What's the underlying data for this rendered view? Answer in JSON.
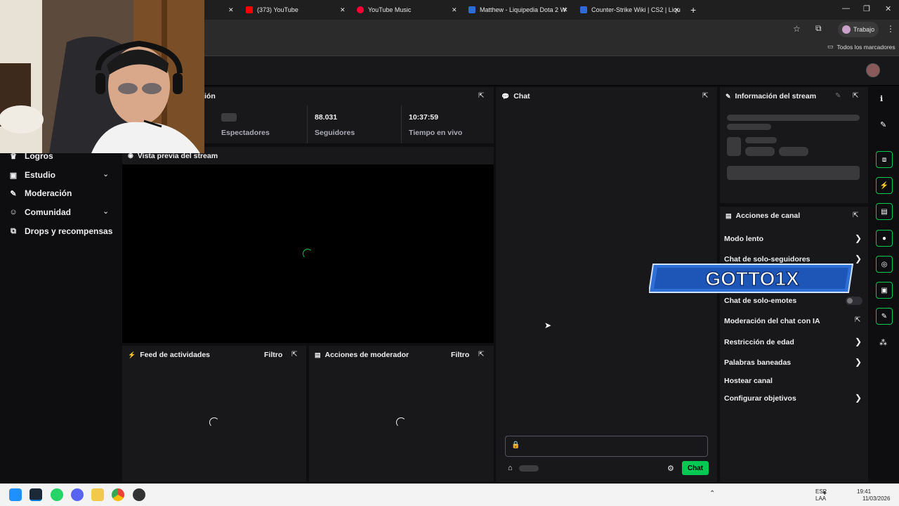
{
  "browser": {
    "tabs": [
      {
        "label": "(373) YouTube",
        "favicon_color": "#ff0000"
      },
      {
        "label": "YouTube Music",
        "favicon_color": "#ff0033"
      },
      {
        "label": "Matthew - Liquipedia Dota 2 W",
        "favicon_color": "#2b6cd6"
      },
      {
        "label": "Counter-Strike Wiki | CS2 | Liqu",
        "favicon_color": "#2b6cd6"
      }
    ],
    "new_tab": "+",
    "tab_close": "✕",
    "minimize": "—",
    "maximize": "❐",
    "close": "✕",
    "profile_label": "Trabajo",
    "bookmarks_folder": "Todos los marcadores"
  },
  "nav": {
    "items": [
      {
        "label": "Logros",
        "icon": "trophy-icon",
        "glyph": "🏆",
        "chevron": false
      },
      {
        "label": "Estudio",
        "icon": "camera-icon",
        "glyph": "▣",
        "chevron": true
      },
      {
        "label": "Moderación",
        "icon": "wrench-icon",
        "glyph": "✎",
        "chevron": false
      },
      {
        "label": "Comunidad",
        "icon": "people-icon",
        "glyph": "👥",
        "chevron": true
      },
      {
        "label": "Drops y recompensas",
        "icon": "gift-icon",
        "glyph": "⧉",
        "chevron": false
      }
    ],
    "chevron_glyph": "⌄"
  },
  "stats_panel": {
    "title_fragment": "ión",
    "stats": [
      {
        "value": "",
        "label": "Espectadores"
      },
      {
        "value": "88.031",
        "label": "Seguidores"
      },
      {
        "value": "10:37:59",
        "label": "Tiempo en vivo"
      }
    ]
  },
  "preview": {
    "title": "Vista previa del stream"
  },
  "activity": {
    "title": "Feed de actividades",
    "filter": "Filtro"
  },
  "mod_actions": {
    "title": "Acciones de moderador",
    "filter": "Filtro"
  },
  "chat": {
    "title": "Chat",
    "input_placeholder": "",
    "send_label": "Chat",
    "accent": "#00c853"
  },
  "stream_info": {
    "title": "Información del stream"
  },
  "channel_actions": {
    "title": "Acciones de canal",
    "items": [
      {
        "label": "Modo lento",
        "chevron": true
      },
      {
        "label": "Chat de solo-seguidores",
        "chevron": true
      },
      {
        "label": "Chat de solo-emotes",
        "toggle": true,
        "toggle_on": false
      },
      {
        "label": "Moderación del chat con IA",
        "external": true
      },
      {
        "label": "Restricción de edad",
        "chevron": true
      },
      {
        "label": "Palabras baneadas",
        "chevron": true
      },
      {
        "label": "Hostear canal",
        "chevron": false
      },
      {
        "label": "Configurar objetivos",
        "chevron": true
      }
    ]
  },
  "overlay": {
    "text": "GOTTO1X"
  },
  "rail": {
    "icons": [
      "info-icon",
      "pencil-icon",
      "clip-icon",
      "lightning-icon",
      "document-icon",
      "chat-bubble-icon",
      "broadcast-icon",
      "panel-icon",
      "wrench-icon",
      "more-icon"
    ]
  },
  "taskbar": {
    "lang_top": "ESP",
    "lang_bottom": "LAA",
    "time": "19:41",
    "date": "11/03/2026"
  }
}
